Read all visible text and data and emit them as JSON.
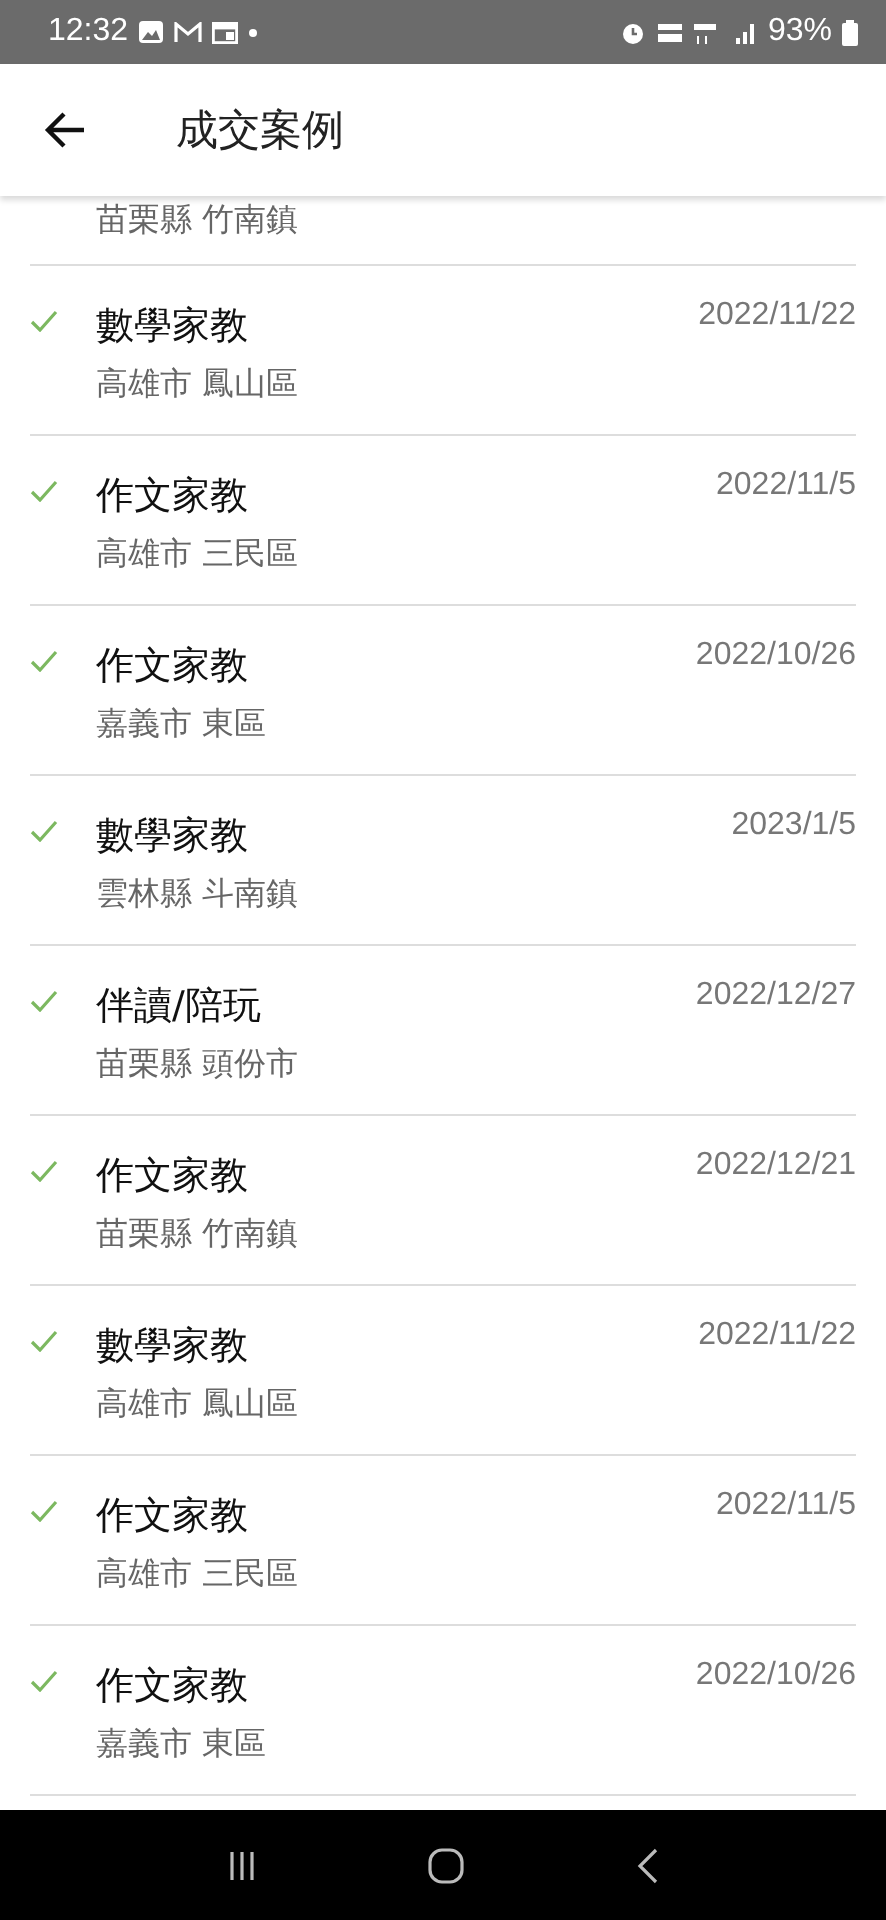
{
  "status_bar": {
    "time": "12:32",
    "battery": "93%"
  },
  "app_bar": {
    "title": "成交案例"
  },
  "partial_row": {
    "location": "苗栗縣 竹南鎮"
  },
  "cases": [
    {
      "subject": "數學家教",
      "location": "高雄市 鳳山區",
      "date": "2022/11/22",
      "checked": true
    },
    {
      "subject": "作文家教",
      "location": "高雄市 三民區",
      "date": "2022/11/5",
      "checked": true
    },
    {
      "subject": "作文家教",
      "location": "嘉義市 東區",
      "date": "2022/10/26",
      "checked": true
    },
    {
      "subject": "數學家教",
      "location": "雲林縣 斗南鎮",
      "date": "2023/1/5",
      "checked": true
    },
    {
      "subject": "伴讀/陪玩",
      "location": "苗栗縣 頭份市",
      "date": "2022/12/27",
      "checked": true
    },
    {
      "subject": "作文家教",
      "location": "苗栗縣 竹南鎮",
      "date": "2022/12/21",
      "checked": true
    },
    {
      "subject": "數學家教",
      "location": "高雄市 鳳山區",
      "date": "2022/11/22",
      "checked": true
    },
    {
      "subject": "作文家教",
      "location": "高雄市 三民區",
      "date": "2022/11/5",
      "checked": true
    },
    {
      "subject": "作文家教",
      "location": "嘉義市 東區",
      "date": "2022/10/26",
      "checked": true
    }
  ]
}
